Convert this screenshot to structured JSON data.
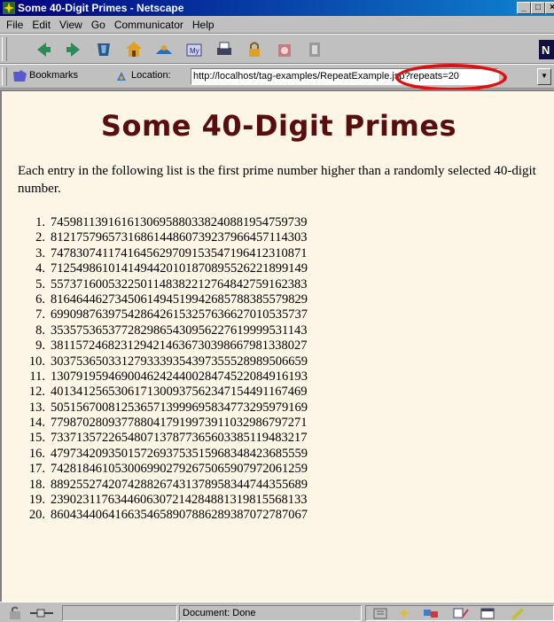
{
  "window": {
    "title": "Some 40-Digit Primes - Netscape"
  },
  "menubar": {
    "items": [
      "File",
      "Edit",
      "View",
      "Go",
      "Communicator",
      "Help"
    ]
  },
  "toolbar": {
    "icons": [
      "back-icon",
      "forward-icon",
      "reload-icon",
      "home-icon",
      "search-icon",
      "netscape-guide-icon",
      "print-icon",
      "security-icon",
      "shop-icon",
      "stop-icon"
    ]
  },
  "locationbar": {
    "bookmarks_label": "Bookmarks",
    "location_label": "Location:",
    "url": "http://localhost/tag-examples/RepeatExample.jsp?repeats=20"
  },
  "page": {
    "heading": "Some 40-Digit Primes",
    "intro": "Each entry in the following list is the first prime number higher than a randomly selected 40-digit number.",
    "primes": [
      "7459811391616130695880338240881954759739",
      "8121757965731686144860739237966457114303",
      "7478307411741645629709153547196412310871",
      "7125498610141494420101870895526221899149",
      "5573716005322501148382212764842759162383",
      "8164644627345061494519942685788385579829",
      "6990987639754286426153257636627010535737",
      "3535753653772829865430956227619999531143",
      "3811572468231294214636730398667981338027",
      "3037536503312793339354397355528989506659",
      "1307919594690046242440028474522084916193",
      "4013412565306171300937562347154491167469",
      "5051567008125365713999695834773295979169",
      "7798702809377880417919973911032986797271",
      "7337135722654807137877365603385119483217",
      "4797342093501572693753515968348423685559",
      "7428184610530069902792675065907972061259",
      "8892552742074288267431378958344744355689",
      "2390231176344606307214284881319815568133",
      "8604344064166354658907886289387072787067"
    ]
  },
  "statusbar": {
    "text": "Document: Done"
  },
  "colors": {
    "heading": "#5a0d0d",
    "content_bg": "#fdf5e6",
    "titlebar": "#000080",
    "highlight": "#e01010"
  }
}
